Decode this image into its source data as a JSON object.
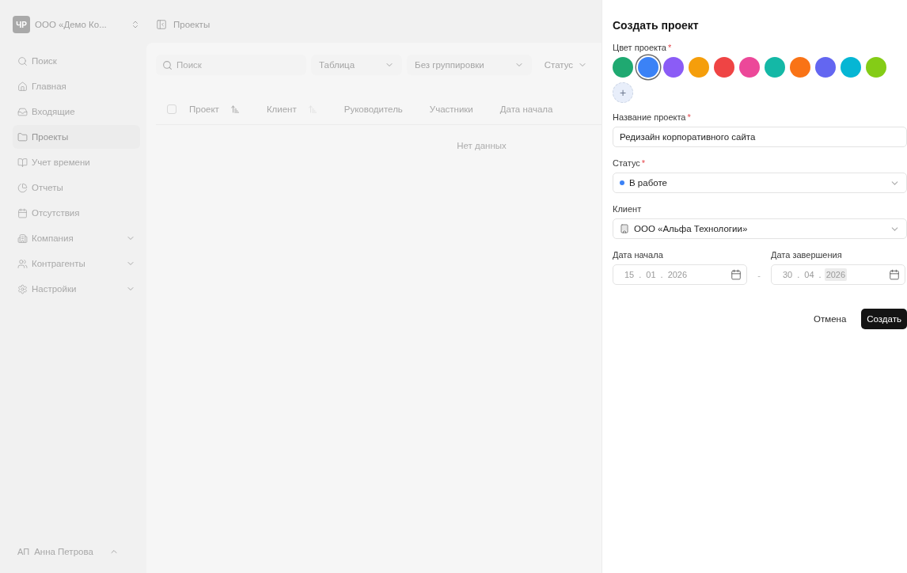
{
  "sidebar": {
    "org": {
      "logo": "ЧР",
      "name": "ООО «Демо Ко..."
    },
    "items": [
      {
        "label": "Поиск",
        "selected": false,
        "expandable": false
      },
      {
        "label": "Главная",
        "selected": false,
        "expandable": false
      },
      {
        "label": "Входящие",
        "selected": false,
        "expandable": false
      },
      {
        "label": "Проекты",
        "selected": true,
        "expandable": false
      },
      {
        "label": "Учет времени",
        "selected": false,
        "expandable": false
      },
      {
        "label": "Отчеты",
        "selected": false,
        "expandable": false
      },
      {
        "label": "Отсутствия",
        "selected": false,
        "expandable": false
      },
      {
        "label": "Компания",
        "selected": false,
        "expandable": true
      },
      {
        "label": "Контрагенты",
        "selected": false,
        "expandable": true
      },
      {
        "label": "Настройки",
        "selected": false,
        "expandable": true
      }
    ],
    "user": {
      "initials": "АП",
      "name": "Анна Петрова"
    }
  },
  "header": {
    "title": "Проекты"
  },
  "toolbar": {
    "search": {
      "placeholder": "Поиск"
    },
    "filters": [
      {
        "label": "Таблица",
        "kind": "select"
      },
      {
        "label": "Без группировки",
        "kind": "select"
      },
      {
        "label": "Статус",
        "kind": "filter"
      }
    ]
  },
  "table": {
    "select_all": {
      "checked": false
    },
    "columns": [
      {
        "label": "Проект",
        "sorted": true
      },
      {
        "label": "Клиент",
        "sorted": false
      },
      {
        "label": "Руководитель"
      },
      {
        "label": "Участники"
      },
      {
        "label": "Дата начала"
      }
    ],
    "empty": "Нет данных"
  },
  "dialog": {
    "title": "Создать проект",
    "color": {
      "label": "Цвет проекта",
      "required_mark": "*",
      "options": [
        {
          "color": "#1fa971",
          "selected": false
        },
        {
          "color": "#3b82f6",
          "selected": true
        },
        {
          "color": "#8b5cf6",
          "selected": false
        },
        {
          "color": "#f59e0b",
          "selected": false
        },
        {
          "color": "#ef4444",
          "selected": false
        },
        {
          "color": "#ec4899",
          "selected": false
        },
        {
          "color": "#14b8a6",
          "selected": false
        },
        {
          "color": "#f97316",
          "selected": false
        },
        {
          "color": "#6366f1",
          "selected": false
        },
        {
          "color": "#06b6d4",
          "selected": false
        },
        {
          "color": "#84cc16",
          "selected": false
        }
      ],
      "add": "+"
    },
    "name": {
      "label": "Название проекта",
      "required_mark": "*",
      "value": "Редизайн корпоративного сайта"
    },
    "status": {
      "label": "Статус",
      "required_mark": "*",
      "value": "В работе",
      "color": "#3b82f6"
    },
    "client": {
      "label": "Клиент",
      "value": "ООО «Альфа Технологии»"
    },
    "start": {
      "label": "Дата начала",
      "segments": [
        {
          "text": "15",
          "selected": false
        },
        {
          "text": ".",
          "selected": false
        },
        {
          "text": "01",
          "selected": false
        },
        {
          "text": ".",
          "selected": false
        },
        {
          "text": "2026",
          "selected": false
        }
      ]
    },
    "range_separator": "-",
    "end": {
      "label": "Дата завершения",
      "segments": [
        {
          "text": "30",
          "selected": false
        },
        {
          "text": ".",
          "selected": false
        },
        {
          "text": "04",
          "selected": false
        },
        {
          "text": ".",
          "selected": false
        },
        {
          "text": "2026",
          "selected": true
        }
      ]
    },
    "buttons": [
      {
        "label": "Отмена",
        "kind": "ghost"
      },
      {
        "label": "Создать",
        "kind": "primary"
      }
    ]
  }
}
